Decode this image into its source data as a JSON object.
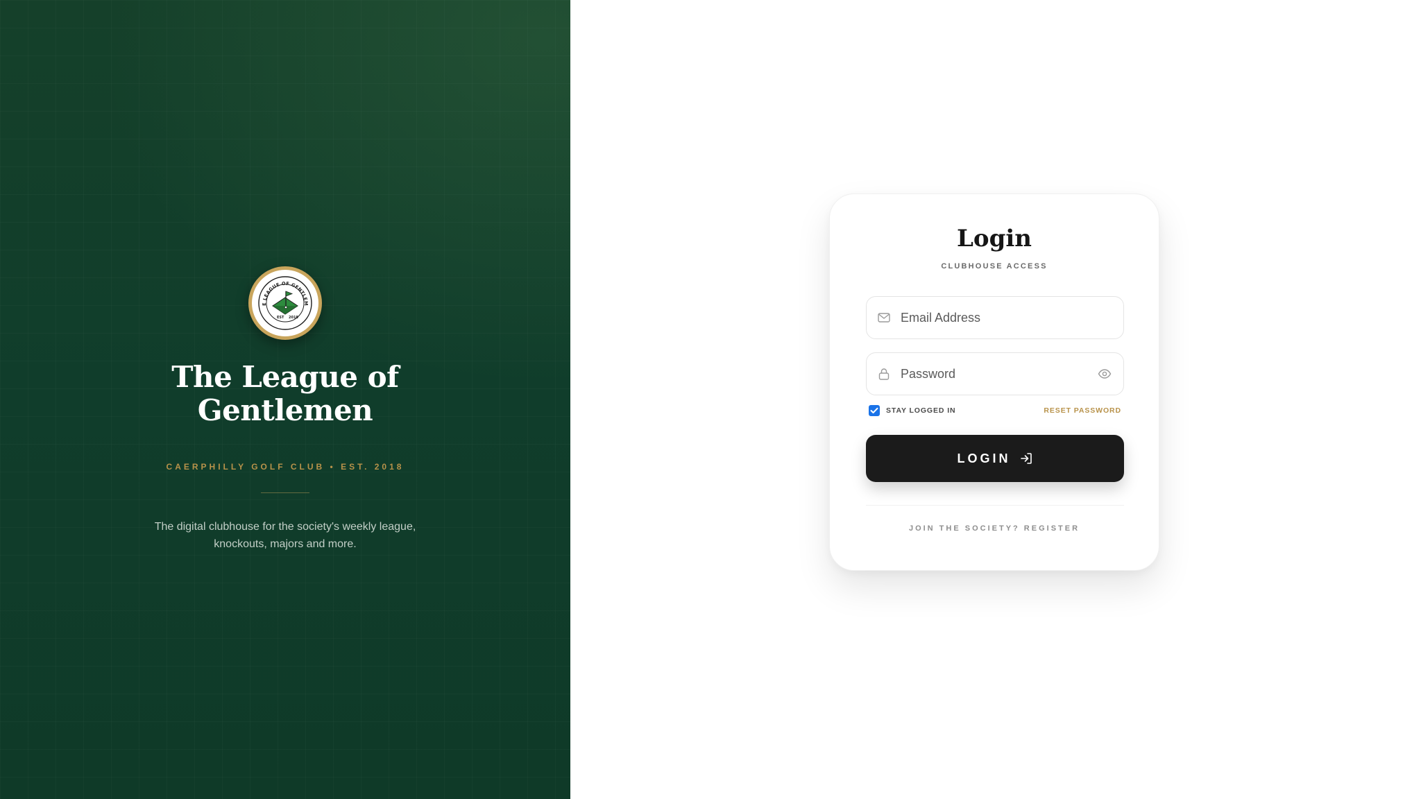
{
  "brand": {
    "crest": {
      "ring_text": "THE LEAGUE OF GENTLEMEN",
      "est_text": "EST. 2018",
      "icon": "golf-flag-crest"
    },
    "title": "The League of Gentlemen",
    "subtitle": "CAERPHILLY GOLF CLUB • EST. 2018",
    "tagline": "The digital clubhouse for the society's weekly league, knockouts, majors and more."
  },
  "login": {
    "title": "Login",
    "subtitle": "CLUBHOUSE ACCESS",
    "email": {
      "placeholder": "Email Address",
      "value": "",
      "icon": "mail-icon"
    },
    "password": {
      "placeholder": "Password",
      "value": "",
      "icon": "lock-icon",
      "toggle_icon": "eye-icon"
    },
    "remember": {
      "label": "STAY LOGGED IN",
      "checked": true
    },
    "reset_label": "RESET PASSWORD",
    "button_label": "LOGIN",
    "button_icon": "login-arrow-icon",
    "register_label": "JOIN THE SOCIETY? REGISTER"
  },
  "colors": {
    "brand_green": "#103d2b",
    "gold": "#b8924a",
    "button_dark": "#1b1b1b",
    "checkbox_blue": "#1a73e8"
  }
}
